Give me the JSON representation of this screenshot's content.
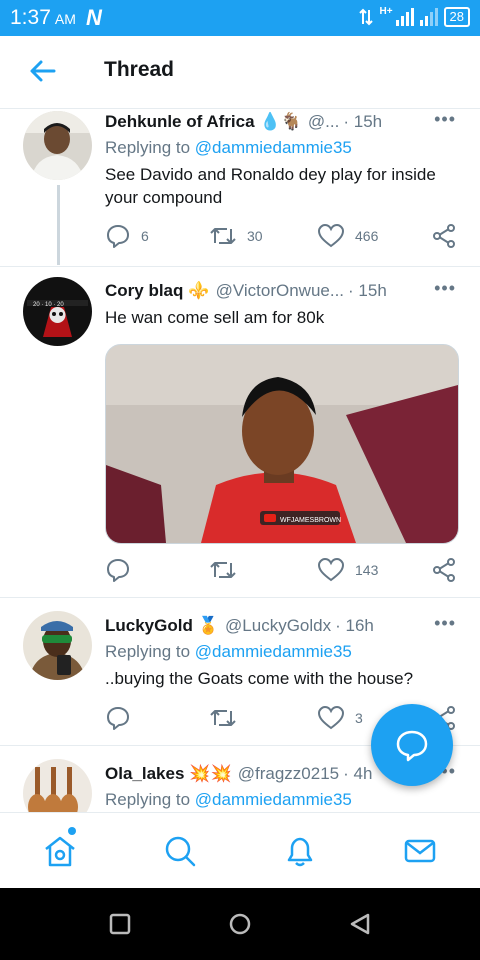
{
  "status_bar": {
    "time": "1:37",
    "ampm": "AM",
    "carrier_glyph": "N",
    "network": "H+",
    "battery": "28"
  },
  "header": {
    "title": "Thread"
  },
  "tweets": [
    {
      "name": "Dehkunle of Africa",
      "emoji": "💧🐐",
      "handle": "@...",
      "time": "· 15h",
      "replying_prefix": "Replying to ",
      "mention": "@dammiedammie35",
      "text": "See Davido and Ronaldo dey play for inside your compound",
      "replies": "6",
      "retweets": "30",
      "likes": "466"
    },
    {
      "name": "Cory blaq",
      "emoji": "⚜️",
      "handle": "@VictorOnwue...",
      "time": "· 15h",
      "text": "He wan come sell am for 80k",
      "media_watermark": "WFJAMESBROWN",
      "replies": "",
      "retweets": "",
      "likes": "143"
    },
    {
      "name": "LuckyGold",
      "emoji": "🏅",
      "handle": "@LuckyGoldx",
      "time": "· 16h",
      "replying_prefix": "Replying to ",
      "mention": "@dammiedammie35",
      "text": "..buying the Goats come with the house?",
      "replies": "",
      "retweets": "",
      "likes": "3"
    },
    {
      "name": "Ola_lakes",
      "emoji": "💥💥",
      "handle": "@fragzz0215",
      "time": "· 4h",
      "replying_prefix": "Replying to ",
      "mention": "@dammiedammie35"
    }
  ],
  "icons": {
    "nav": [
      "home-icon",
      "search-icon",
      "bell-icon",
      "mail-icon"
    ],
    "actions": [
      "reply-icon",
      "retweet-icon",
      "like-icon",
      "share-icon"
    ]
  },
  "colors": {
    "brand": "#1da1f2",
    "muted": "#657786",
    "text": "#14171a"
  }
}
